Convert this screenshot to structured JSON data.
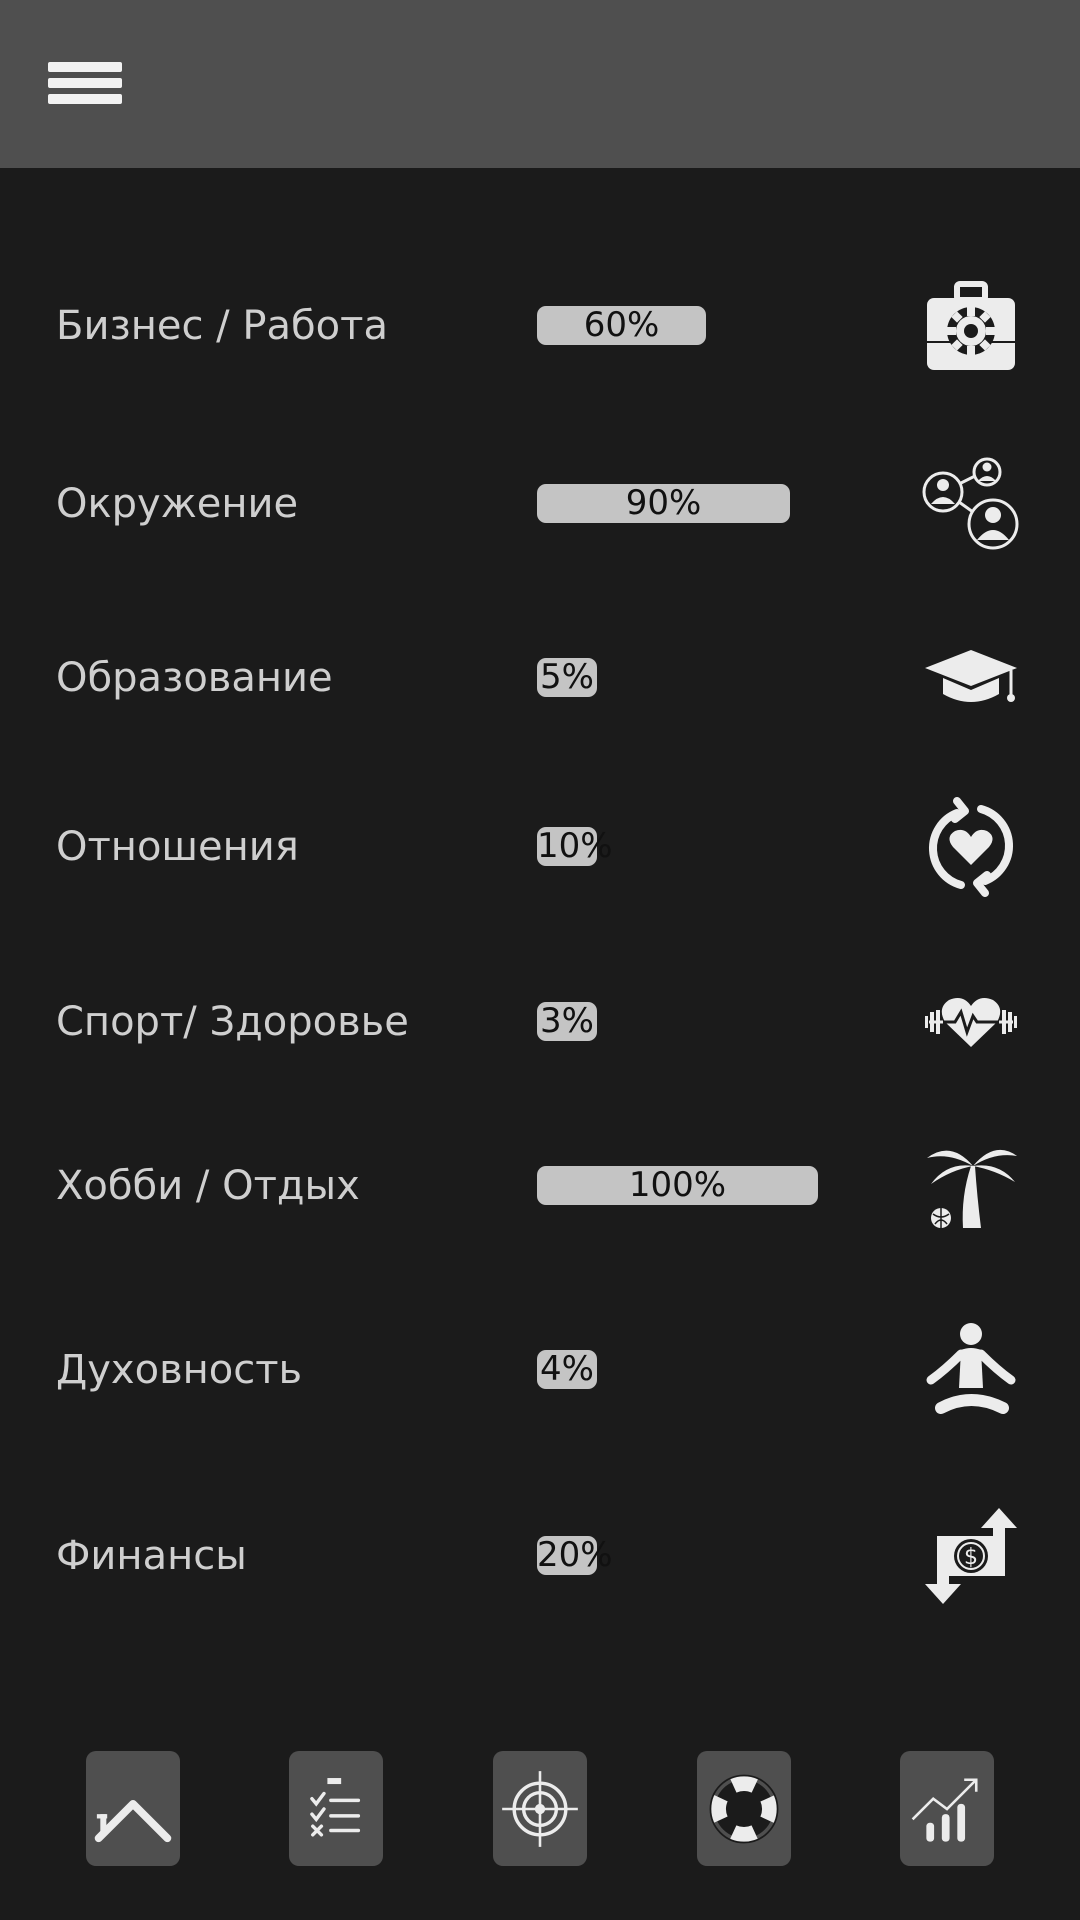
{
  "categories": [
    {
      "label": "Бизнес / Работа",
      "percent_text": "60%",
      "percent": 60,
      "icon": "briefcase-gear-icon"
    },
    {
      "label": "Окружение",
      "percent_text": "90%",
      "percent": 90,
      "icon": "people-network-icon"
    },
    {
      "label": "Образование",
      "percent_text": "5%",
      "percent": 5,
      "icon": "graduation-cap-icon"
    },
    {
      "label": "Отношения",
      "percent_text": "10%",
      "percent": 10,
      "icon": "heart-refresh-icon"
    },
    {
      "label": "Спорт/ Здоровье",
      "percent_text": "3%",
      "percent": 3,
      "icon": "heart-dumbbell-icon"
    },
    {
      "label": "Хобби / Отдых",
      "percent_text": "100%",
      "percent": 100,
      "icon": "palm-tree-icon"
    },
    {
      "label": "Духовность",
      "percent_text": "4%",
      "percent": 4,
      "icon": "meditation-icon"
    },
    {
      "label": "Финансы",
      "percent_text": "20%",
      "percent": 20,
      "icon": "money-exchange-icon"
    }
  ],
  "nav": [
    {
      "icon": "home-icon"
    },
    {
      "icon": "checklist-icon"
    },
    {
      "icon": "target-icon"
    },
    {
      "icon": "lifebuoy-icon"
    },
    {
      "icon": "growth-chart-icon"
    }
  ],
  "colors": {
    "background": "#1b1b1b",
    "topbar": "#4f4f4f",
    "bar_fill": "#c4c4c4",
    "label_text": "#cfcfcf",
    "icon": "#ececec"
  }
}
